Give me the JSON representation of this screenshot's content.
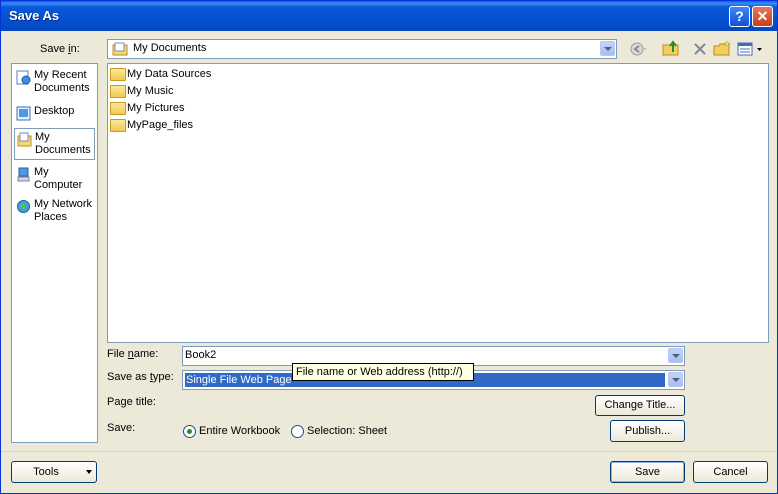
{
  "window": {
    "title": "Save As",
    "help_symbol": "?",
    "close_symbol": "✕"
  },
  "save_in": {
    "label": "Save in:",
    "value": "My Documents",
    "icon": "my-documents-icon"
  },
  "toolbar": {
    "icons": [
      "back-icon",
      "up-folder-icon",
      "delete-icon",
      "new-folder-icon",
      "views-icon"
    ]
  },
  "places_bar": [
    {
      "label": "My Recent Documents",
      "icon": "recent-documents-icon"
    },
    {
      "label": "Desktop",
      "icon": "desktop-icon"
    },
    {
      "label": "My Documents",
      "icon": "my-documents-icon",
      "selected": true
    },
    {
      "label": "My Computer",
      "icon": "my-computer-icon"
    },
    {
      "label": "My Network Places",
      "icon": "network-places-icon"
    }
  ],
  "files": [
    {
      "name": "My Data Sources",
      "icon": "data-sources-folder-icon"
    },
    {
      "name": "My Music",
      "icon": "music-folder-icon"
    },
    {
      "name": "My Pictures",
      "icon": "pictures-folder-icon"
    },
    {
      "name": "MyPage_files",
      "icon": "folder-icon"
    }
  ],
  "form": {
    "file_name_label": "File name:",
    "file_name_value": "Book2",
    "save_as_type_label": "Save as type:",
    "save_as_type_value": "Single File Web Page",
    "page_title_label": "Page title:",
    "save_label": "Save:",
    "option_entire_workbook": "Entire Workbook",
    "option_selection": "Selection: Sheet",
    "selected_option": "entire_workbook"
  },
  "tooltip": "File name or Web address (http://)",
  "buttons": {
    "change_title": "Change Title...",
    "publish": "Publish...",
    "tools": "Tools",
    "save": "Save",
    "cancel": "Cancel"
  },
  "colors": {
    "titlebar": "#0450d0",
    "selection": "#316ac5",
    "dialog_bg": "#ece9d8"
  }
}
